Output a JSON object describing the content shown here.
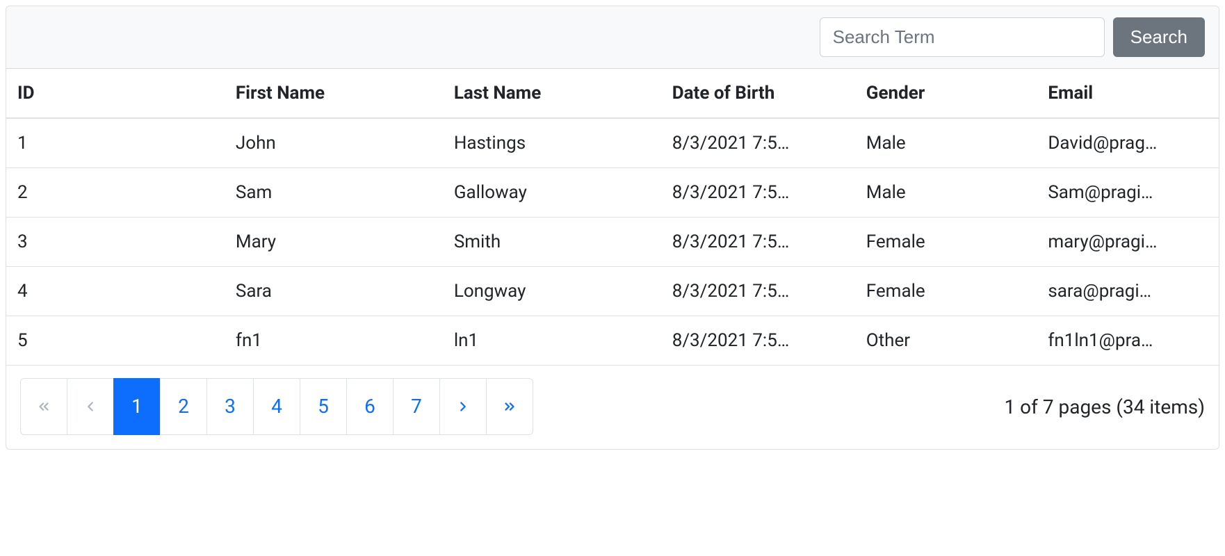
{
  "search": {
    "placeholder": "Search Term",
    "button_label": "Search"
  },
  "table": {
    "headers": {
      "id": "ID",
      "first_name": "First Name",
      "last_name": "Last Name",
      "dob": "Date of Birth",
      "gender": "Gender",
      "email": "Email"
    },
    "rows": [
      {
        "id": "1",
        "first_name": "John",
        "last_name": "Hastings",
        "dob": "8/3/2021 7:5…",
        "gender": "Male",
        "email": "David@prag…"
      },
      {
        "id": "2",
        "first_name": "Sam",
        "last_name": "Galloway",
        "dob": "8/3/2021 7:5…",
        "gender": "Male",
        "email": "Sam@pragi…"
      },
      {
        "id": "3",
        "first_name": "Mary",
        "last_name": "Smith",
        "dob": "8/3/2021 7:5…",
        "gender": "Female",
        "email": "mary@pragi…"
      },
      {
        "id": "4",
        "first_name": "Sara",
        "last_name": "Longway",
        "dob": "8/3/2021 7:5…",
        "gender": "Female",
        "email": "sara@pragi…"
      },
      {
        "id": "5",
        "first_name": "fn1",
        "last_name": "ln1",
        "dob": "8/3/2021 7:5…",
        "gender": "Other",
        "email": "fn1ln1@pra…"
      }
    ]
  },
  "pagination": {
    "pages": [
      "1",
      "2",
      "3",
      "4",
      "5",
      "6",
      "7"
    ],
    "active_index": 0,
    "prev_disabled": true,
    "info": "1 of 7 pages (34 items)"
  }
}
